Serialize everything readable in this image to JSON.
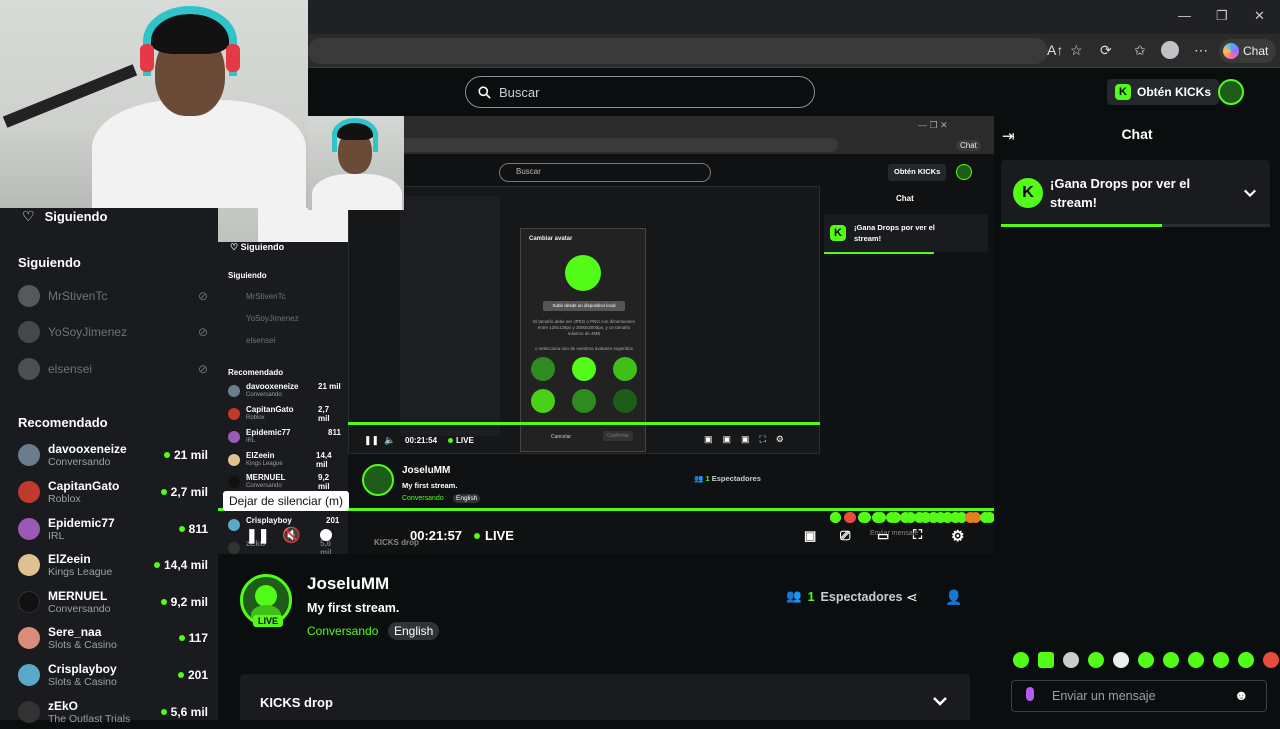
{
  "browser": {
    "chat_label": "Chat"
  },
  "header": {
    "search_placeholder": "Buscar",
    "kicks_button": "Obtén KICKs"
  },
  "sidebar": {
    "following_header": "Siguiendo",
    "following_title": "Siguiendo",
    "following": [
      {
        "name": "MrStivenTc"
      },
      {
        "name": "YoSoyJimenez"
      },
      {
        "name": "elsensei"
      }
    ],
    "recommended_title": "Recomendado",
    "recommended": [
      {
        "name": "davooxeneize",
        "category": "Conversando",
        "viewers": "21 mil",
        "color": "#6b7d8c"
      },
      {
        "name": "CapitanGato",
        "category": "Roblox",
        "viewers": "2,7 mil",
        "color": "#c0392b"
      },
      {
        "name": "Epidemic77",
        "category": "IRL",
        "viewers": "811",
        "color": "#9b59b6"
      },
      {
        "name": "ElZeein",
        "category": "Kings League",
        "viewers": "14,4 mil",
        "color": "#e0c090"
      },
      {
        "name": "MERNUEL",
        "category": "Conversando",
        "viewers": "9,2 mil",
        "color": "#111111"
      },
      {
        "name": "Sere_naa",
        "category": "Slots & Casino",
        "viewers": "117",
        "color": "#d88c7a"
      },
      {
        "name": "Crisplayboy",
        "category": "Slots & Casino",
        "viewers": "201",
        "color": "#5aa9c9"
      },
      {
        "name": "zEkO",
        "category": "The Outlast Trials",
        "viewers": "5,6 mil",
        "color": "#333333"
      }
    ]
  },
  "player": {
    "tooltip": "Dejar de silenciar (m)",
    "time": "00:21:57",
    "live_label": "LIVE",
    "progress": 1.0
  },
  "nested": {
    "search_placeholder": "Buscar",
    "kicks_button": "Obtén KICKs",
    "chat_title": "Chat",
    "drops_text": "¡Gana Drops por ver el stream!",
    "following_header": "Siguiendo",
    "following_title": "Siguiendo",
    "following": [
      "MrStivenTc",
      "YoSoyJimenez",
      "elsensei"
    ],
    "recommended_title": "Recomendado",
    "recommended": [
      {
        "name": "davooxeneize",
        "category": "Conversando",
        "viewers": "21 mil"
      },
      {
        "name": "CapitanGato",
        "category": "Roblox",
        "viewers": "2,7 mil"
      },
      {
        "name": "Epidemic77",
        "category": "IRL",
        "viewers": "811"
      },
      {
        "name": "ElZeein",
        "category": "Kings League",
        "viewers": "14,4 mil"
      },
      {
        "name": "MERNUEL",
        "category": "Conversando",
        "viewers": "9,2 mil"
      },
      {
        "name": "Crisplayboy",
        "category": "",
        "viewers": "201"
      },
      {
        "name": "zEkO",
        "category": "",
        "viewers": "5,6 mil"
      }
    ],
    "time": "00:21:54",
    "live_label": "LIVE",
    "streamer_name": "JoseluMM",
    "stream_title": "My first stream.",
    "category": "Conversando",
    "language": "English",
    "viewers_count": "1",
    "viewers_label": "Espectadores",
    "kicks_drop": "KICKS drop",
    "message_placeholder": "Enviar mensaje",
    "modal_title": "Cambiar avatar",
    "modal_upload": "Subir desde un dispositivo local",
    "modal_desc": "El tamaño debe ser JPEG o PNG con dimensiones entre 128x128px y 3000x3000px, y un tamaño máximo de 4MB",
    "modal_choose": "o selecciona uno de nuestros avatares sugeridos",
    "modal_cancel": "Cancelar",
    "modal_confirm": "Confirmar"
  },
  "stream": {
    "live_badge": "LIVE",
    "streamer_name": "JoseluMM",
    "title": "My first stream.",
    "category": "Conversando",
    "language": "English",
    "viewers_count": "1",
    "viewers_label": "Espectadores",
    "kicks_drop": "KICKS drop"
  },
  "chat": {
    "title": "Chat",
    "drops_text": "¡Gana Drops por ver el stream!",
    "drops_progress": 0.6,
    "message_placeholder": "Enviar un mensaje"
  },
  "colors": {
    "accent": "#53fc18",
    "background": "#0b0e0f",
    "panel": "#191b1f"
  }
}
